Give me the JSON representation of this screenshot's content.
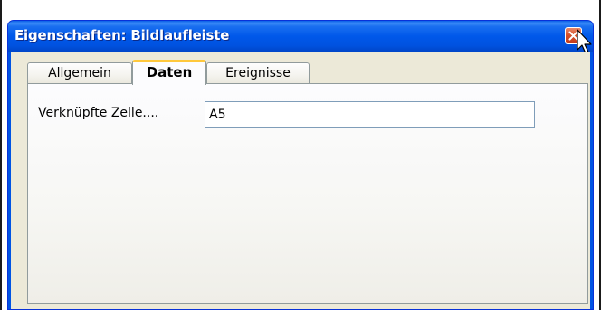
{
  "window": {
    "title": "Eigenschaften: Bildlaufleiste",
    "close_icon": "close-icon"
  },
  "tabs": [
    {
      "label": "Allgemein",
      "selected": false
    },
    {
      "label": "Daten",
      "selected": true
    },
    {
      "label": "Ereignisse",
      "selected": false
    }
  ],
  "form": {
    "linked_cell_label": "Verknüpfte Zelle....",
    "linked_cell_value": "A5"
  },
  "colors": {
    "title_bar": "#0054e3",
    "selected_tab_accent": "#ffc83c",
    "close_button": "#d7502a",
    "dialog_background": "#ece9d8"
  }
}
